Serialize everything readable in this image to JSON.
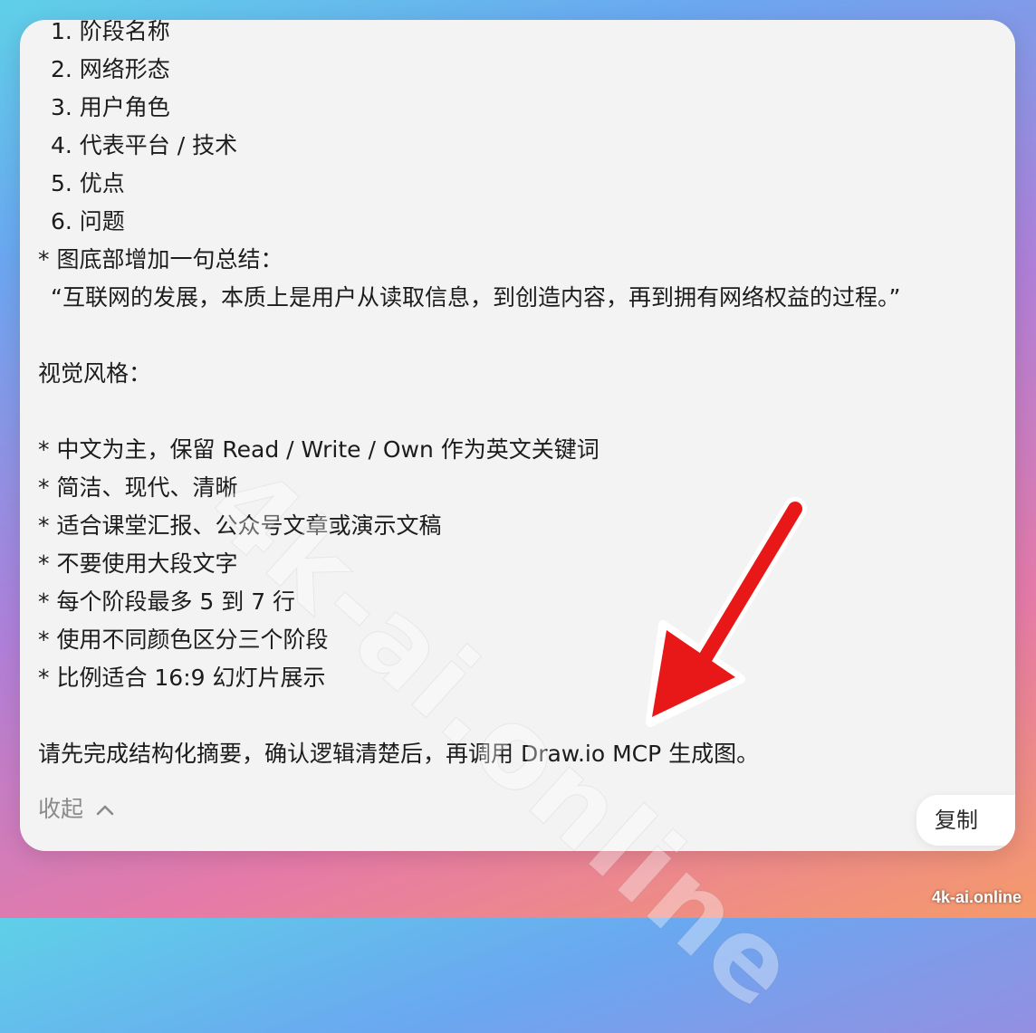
{
  "content": {
    "lines": [
      "1. 阶段名称",
      "2. 网络形态",
      "3. 用户角色",
      "4. 代表平台 / 技术",
      "5. 优点",
      "6. 问题",
      "* 图底部增加一句总结：",
      "“互联网的发展，本质上是用户从读取信息，到创造内容，再到拥有网络权益的过程。”",
      "视觉风格：",
      "* 中文为主，保留 Read / Write / Own 作为英文关键词",
      "* 简洁、现代、清晰",
      "* 适合课堂汇报、公众号文章或演示文稿",
      "* 不要使用大段文字",
      "* 每个阶段最多 5 到 7 行",
      "* 使用不同颜色区分三个阶段",
      "* 比例适合 16:9 幻灯片展示",
      "请先完成结构化摘要，确认逻辑清楚后，再调用 Draw.io MCP 生成图。"
    ]
  },
  "actions": {
    "collapse_label": "收起",
    "copy_label": "复制"
  },
  "watermark": {
    "center_text": "4k-ai.online",
    "corner_text": "4k-ai.online"
  },
  "annotation": {
    "arrow_color": "#e81818"
  }
}
